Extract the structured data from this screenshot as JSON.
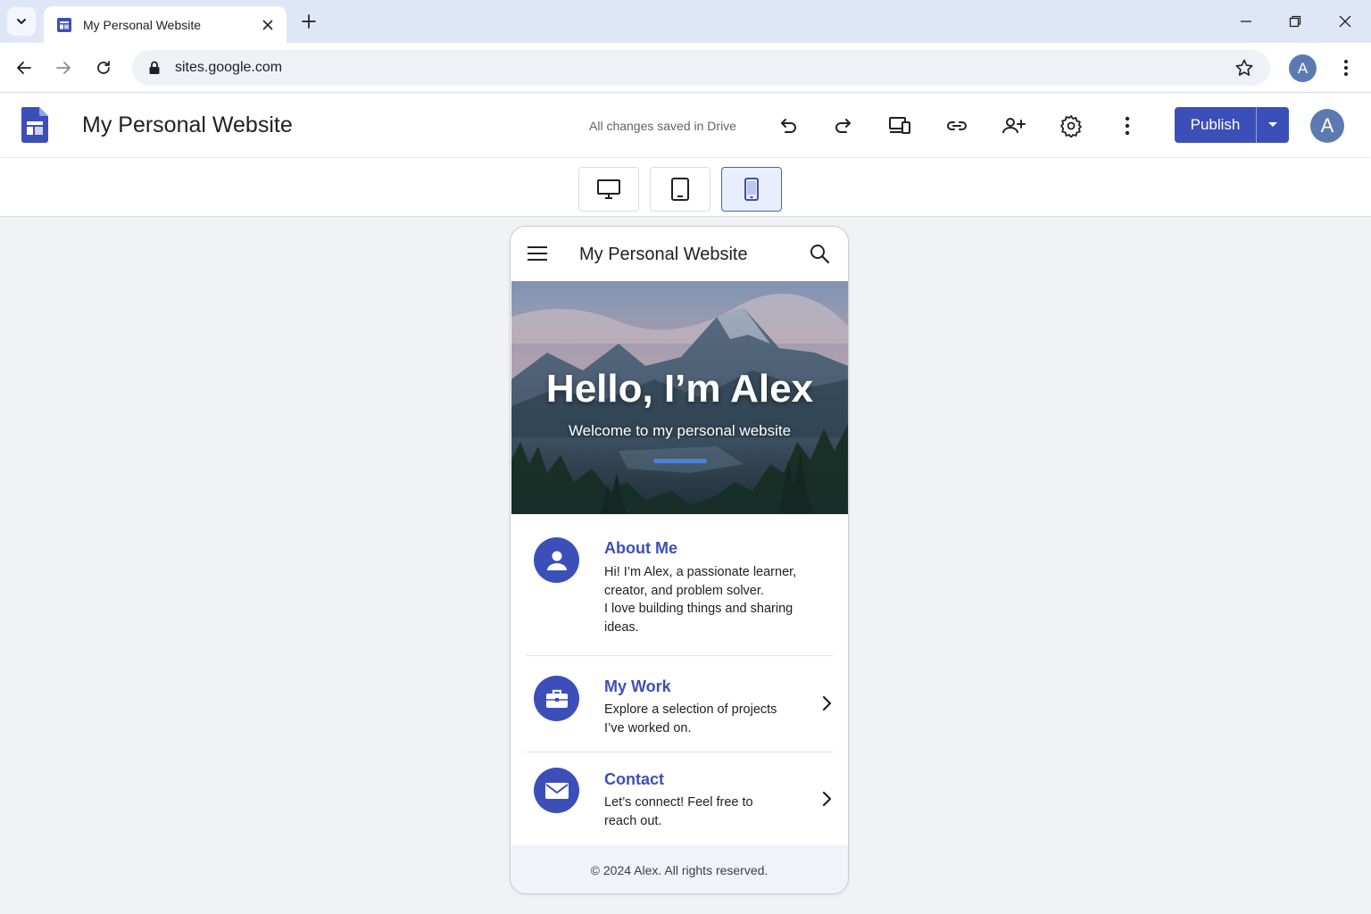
{
  "browser": {
    "tab_title": "My Personal Website",
    "url": "sites.google.com",
    "profile_initial": "A"
  },
  "sites": {
    "site_title": "My Personal Website",
    "save_status": "All changes saved in Drive",
    "publish_label": "Publish",
    "avatar_initial": "A",
    "accent_color": "#3c4fb8",
    "toolbar_icons": [
      "undo-icon",
      "redo-icon",
      "preview-icon",
      "link-icon",
      "share-icon",
      "settings-icon",
      "more-vert-icon"
    ],
    "device_modes": [
      "desktop",
      "tablet",
      "phone"
    ],
    "active_device": "phone"
  },
  "preview": {
    "site_name": "My Personal Website",
    "hero_title": "Hello, I’m Alex",
    "hero_subtitle": "Welcome to my personal website",
    "sections": [
      {
        "icon": "person-icon",
        "title": "About Me",
        "lines": [
          "Hi! I’m Alex, a passionate learner,",
          "creator, and problem solver.",
          "I love building things and sharing",
          "ideas."
        ]
      },
      {
        "icon": "briefcase-icon",
        "title": "My Work",
        "lines": [
          "Explore a selection of projects",
          "I’ve worked on."
        ]
      },
      {
        "icon": "mail-icon",
        "title": "Contact",
        "lines": [
          "Let’s connect! Feel free to",
          "reach out."
        ]
      }
    ],
    "footer": "© 2024 Alex. All rights reserved."
  }
}
